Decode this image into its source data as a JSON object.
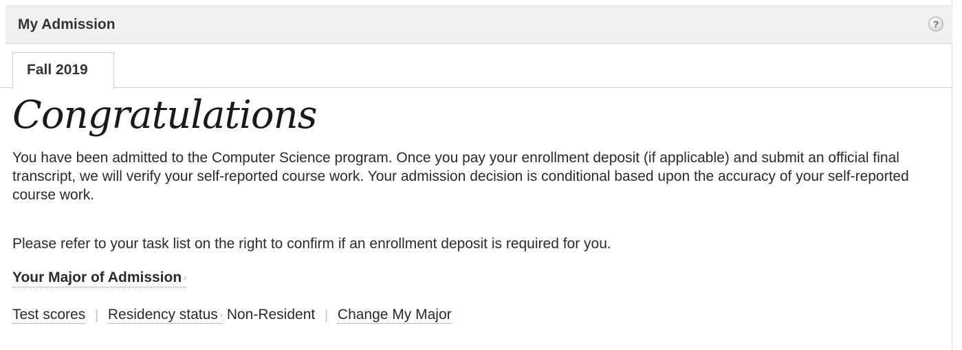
{
  "header": {
    "title": "My Admission",
    "help_icon_glyph": "?"
  },
  "tabs": [
    {
      "label": "Fall 2019",
      "active": true
    }
  ],
  "content": {
    "heading": "Congratulations",
    "paragraph1": "You have been admitted to the Computer Science program. Once you pay your enrollment deposit (if applicable) and submit an official final transcript, we will verify your self-reported course work. Your admission decision is conditional based upon the accuracy of your self-reported course work.",
    "paragraph2": "Please refer to your task list on the right to confirm if an enrollment deposit is required for you.",
    "major_link": "Your Major of Admission",
    "chevron_glyph": "›",
    "links": {
      "test_scores": "Test scores",
      "residency_status": "Residency status",
      "residency_value": "Non-Resident",
      "change_major": "Change My Major",
      "separator": "|"
    }
  },
  "colors": {
    "header_bg": "#f1f1f1",
    "text": "#2a2a2a",
    "border": "#cfcfcf"
  }
}
